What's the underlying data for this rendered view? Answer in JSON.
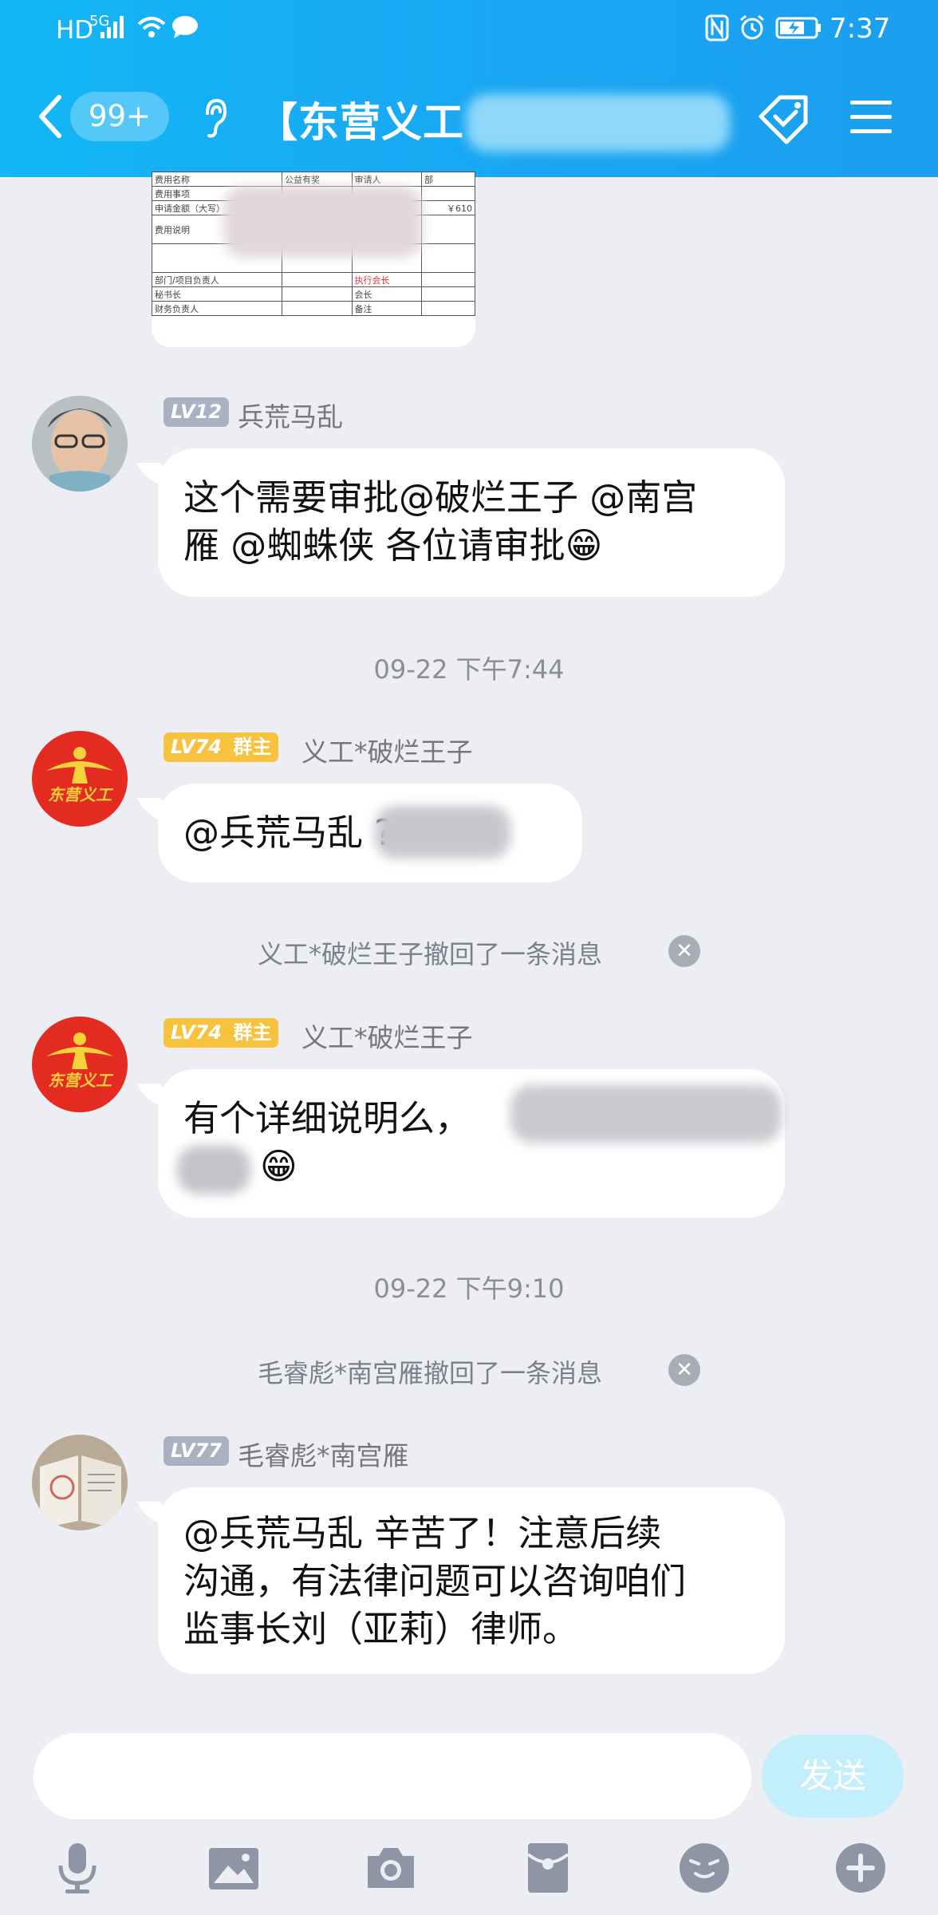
{
  "status_bar": {
    "network": "HD",
    "signal": "5G",
    "time": "7:37"
  },
  "header": {
    "unread_badge": "99+",
    "title": "【东营义工",
    "icons": [
      "back-arrow-icon",
      "earpiece-icon",
      "group-tag-icon",
      "menu-icon"
    ]
  },
  "document_image": {
    "rows": [
      [
        "费用名称",
        "公益有奖",
        "审请人",
        "部"
      ],
      [
        "费用事项",
        "",
        "",
        ""
      ],
      [
        "申请金额（大写）",
        "",
        "",
        "￥610"
      ],
      [
        "费用说明",
        "",
        "",
        ""
      ],
      [
        "",
        "",
        "",
        ""
      ],
      [
        "部门/项目负责人",
        "",
        "执行会长",
        ""
      ],
      [
        "秘书长",
        "",
        "会长",
        ""
      ],
      [
        "财务负责人",
        "",
        "备注",
        ""
      ]
    ]
  },
  "messages": [
    {
      "level": "LV12",
      "role": "",
      "sender": "兵荒马乱",
      "lines": [
        "这个需要审批@破烂王子 @南宫",
        "雁 @蜘蛛侠 各位请审批😁"
      ]
    },
    {
      "level": "LV74",
      "role": "群主",
      "sender": "义工*破烂王子",
      "lines": [
        "@兵荒马乱 ?"
      ]
    },
    {
      "level": "LV74",
      "role": "群主",
      "sender": "义工*破烂王子",
      "lines": [
        "有个详细说明么，",
        "😁"
      ]
    },
    {
      "level": "LV77",
      "role": "",
      "sender": "毛睿彪*南宫雁",
      "lines": [
        "@兵荒马乱 辛苦了！注意后续",
        "沟通，有法律问题可以咨询咱们",
        "监事长刘（亚莉）律师。"
      ]
    }
  ],
  "timestamps": [
    "09-22 下午7:44",
    "09-22 下午9:10"
  ],
  "recall_notices": [
    "义工*破烂王子撤回了一条消息",
    "毛睿彪*南宫雁撤回了一条消息"
  ],
  "avatar_logo_text": "东营义工",
  "input": {
    "placeholder": "",
    "send_label": "发送"
  },
  "toolbar": {
    "icons": [
      "microphone-icon",
      "image-icon",
      "camera-icon",
      "red-packet-icon",
      "emoji-icon",
      "plus-icon"
    ]
  },
  "colors": {
    "header": "#12b7f5",
    "background": "#eceef4",
    "level_grey": "#a9b2c3",
    "level_gold": "#f7c23e",
    "toolbar_icon": "#8e96a6",
    "send_button": "#c3eefc"
  }
}
